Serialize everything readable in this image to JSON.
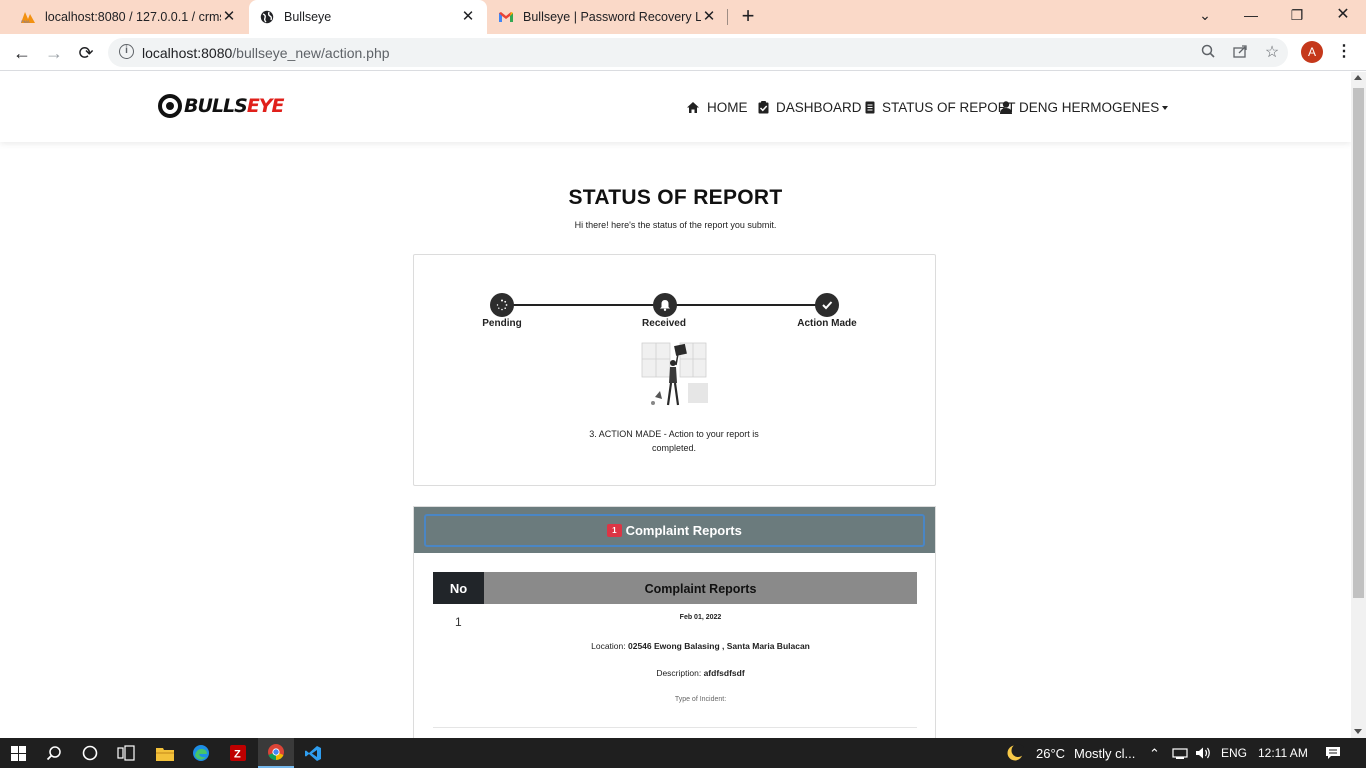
{
  "browser": {
    "tabs": [
      {
        "title": "localhost:8080 / 127.0.0.1 / crms_",
        "favicon": "phpmyadmin-icon"
      },
      {
        "title": "Bullseye",
        "favicon": "globe-icon"
      },
      {
        "title": "Bullseye | Password Recovery Lin",
        "favicon": "gmail-icon"
      }
    ],
    "url_host": "localhost:8080",
    "url_path": "/bullseye_new/action.php",
    "profile_initial": "A"
  },
  "site": {
    "logo_black": "BULLS",
    "logo_red": "EYE",
    "nav": [
      {
        "label": "HOME",
        "icon": "home-icon"
      },
      {
        "label": "DASHBOARD",
        "icon": "clipboard-check-icon"
      },
      {
        "label": "STATUS OF REPORT",
        "icon": "document-icon"
      },
      {
        "label": "DENG HERMOGENES",
        "icon": "user-icon"
      }
    ]
  },
  "page": {
    "title": "STATUS OF REPORT",
    "subtitle": "Hi there! here's the status of the report you submit.",
    "steps": [
      {
        "label": "Pending",
        "icon": "spinner-icon"
      },
      {
        "label": "Received",
        "icon": "bell-icon"
      },
      {
        "label": "Action Made",
        "icon": "check-icon"
      }
    ],
    "status_message": "3. ACTION MADE - Action to your report is completed.",
    "reports": {
      "badge": "1",
      "header": "Complaint Reports",
      "columns": [
        "No",
        "Complaint Reports"
      ],
      "rows": [
        {
          "no": "1",
          "date": "Feb 01, 2022",
          "location_label": "Location:",
          "location": "02546 Ewong Balasing , Santa Maria Bulacan",
          "description_label": "Description:",
          "description": "afdfsdfsdf",
          "type_label": "Type of Incident:"
        }
      ]
    }
  },
  "taskbar": {
    "temperature": "26°C",
    "weather": "Mostly cl...",
    "language": "ENG",
    "time": "12:11 AM"
  }
}
